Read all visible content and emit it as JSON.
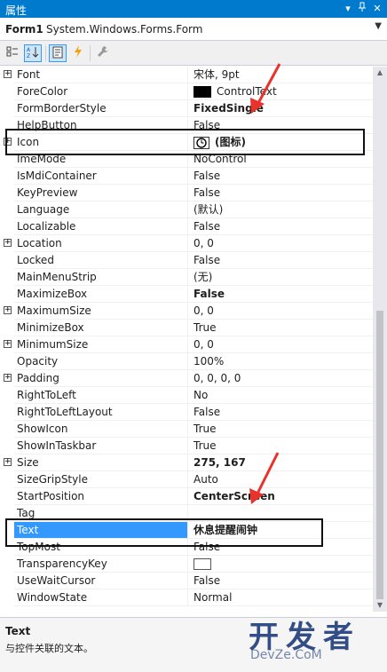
{
  "window": {
    "title": "属性",
    "accent_color": "#007acc",
    "pin_icon": "pin-icon",
    "close_icon": "close-icon"
  },
  "object_selector": {
    "name": "Form1",
    "type": "System.Windows.Forms.Form"
  },
  "toolbar": {
    "buttons": [
      {
        "name": "categorized-button",
        "icon": "categorized-icon"
      },
      {
        "name": "alphabetical-button",
        "icon": "alphabetical-icon",
        "pressed": true
      },
      {
        "name": "properties-button",
        "icon": "properties-icon",
        "pressed": true
      },
      {
        "name": "events-button",
        "icon": "lightning-icon"
      },
      {
        "name": "property-pages-button",
        "icon": "wrench-icon"
      }
    ]
  },
  "properties": [
    {
      "name": "Font",
      "value": "宋体, 9pt",
      "expandable": true
    },
    {
      "name": "ForeColor",
      "value": "ControlText",
      "swatch": "black"
    },
    {
      "name": "FormBorderStyle",
      "value": "FixedSingle",
      "bold": true
    },
    {
      "name": "HelpButton",
      "value": "False"
    },
    {
      "name": "Icon",
      "value": "(图标)",
      "bold": true,
      "expandable": true,
      "icon": true
    },
    {
      "name": "ImeMode",
      "value": "NoControl"
    },
    {
      "name": "IsMdiContainer",
      "value": "False"
    },
    {
      "name": "KeyPreview",
      "value": "False"
    },
    {
      "name": "Language",
      "value": "(默认)"
    },
    {
      "name": "Localizable",
      "value": "False"
    },
    {
      "name": "Location",
      "value": "0, 0",
      "expandable": true
    },
    {
      "name": "Locked",
      "value": "False"
    },
    {
      "name": "MainMenuStrip",
      "value": "(无)"
    },
    {
      "name": "MaximizeBox",
      "value": "False",
      "bold": true
    },
    {
      "name": "MaximumSize",
      "value": "0, 0",
      "expandable": true
    },
    {
      "name": "MinimizeBox",
      "value": "True"
    },
    {
      "name": "MinimumSize",
      "value": "0, 0",
      "expandable": true
    },
    {
      "name": "Opacity",
      "value": "100%"
    },
    {
      "name": "Padding",
      "value": "0, 0, 0, 0",
      "expandable": true
    },
    {
      "name": "RightToLeft",
      "value": "No"
    },
    {
      "name": "RightToLeftLayout",
      "value": "False"
    },
    {
      "name": "ShowIcon",
      "value": "True"
    },
    {
      "name": "ShowInTaskbar",
      "value": "True"
    },
    {
      "name": "Size",
      "value": "275, 167",
      "bold": true,
      "expandable": true
    },
    {
      "name": "SizeGripStyle",
      "value": "Auto"
    },
    {
      "name": "StartPosition",
      "value": "CenterScreen",
      "bold": true
    },
    {
      "name": "Tag",
      "value": ""
    },
    {
      "name": "Text",
      "value": "休息提醒闹钟",
      "bold": true,
      "selected": true
    },
    {
      "name": "TopMost",
      "value": "False"
    },
    {
      "name": "TransparencyKey",
      "value": "",
      "swatch": "white"
    },
    {
      "name": "UseWaitCursor",
      "value": "False"
    },
    {
      "name": "WindowState",
      "value": "Normal"
    }
  ],
  "description": {
    "title": "Text",
    "text": "与控件关联的文本。"
  },
  "watermark": {
    "big": "开发者",
    "small": "DevZe.CoM"
  },
  "colors": {
    "selection": "#3399ff",
    "annotation_arrow": "#e8322b"
  }
}
